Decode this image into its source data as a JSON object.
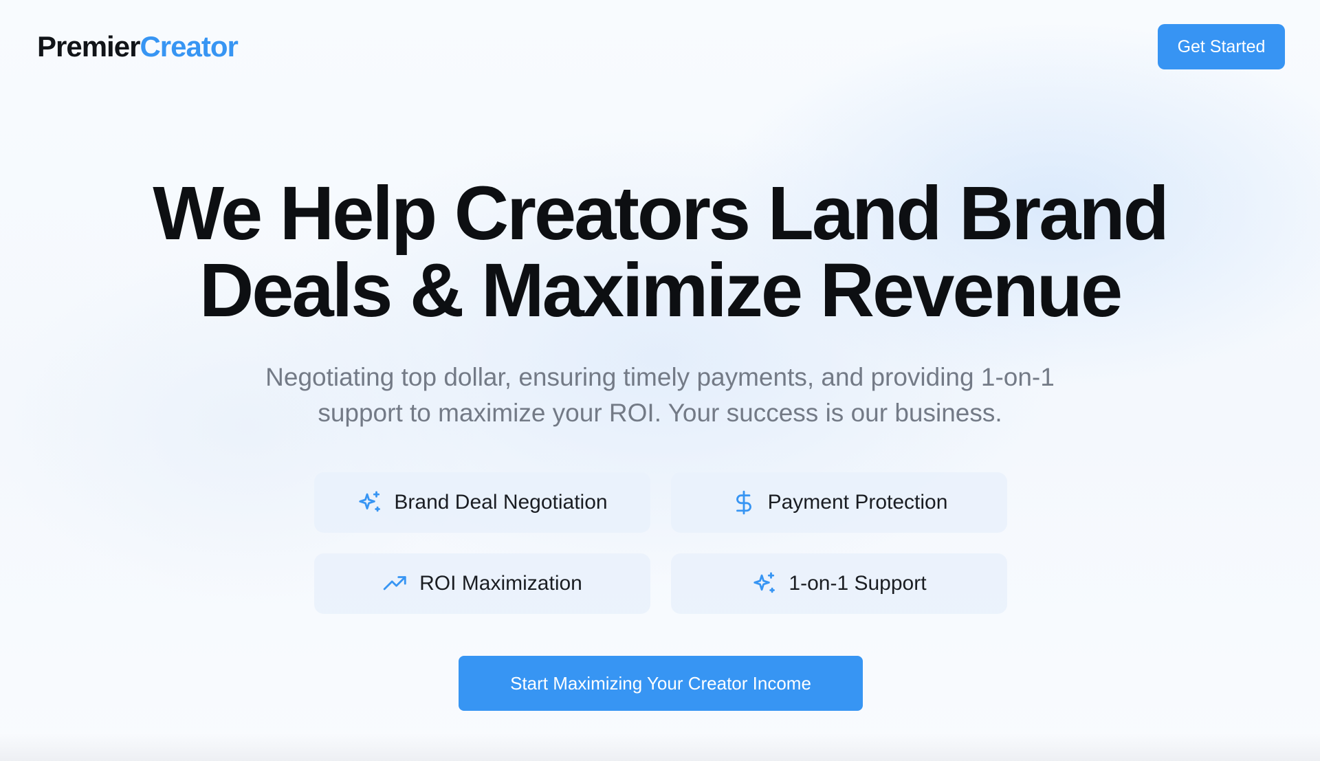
{
  "brand": {
    "name_part1": "Premier",
    "name_part2": "Creator",
    "colors": {
      "text": "#111418",
      "accent": "#3795f3"
    }
  },
  "header": {
    "cta_label": "Get Started"
  },
  "hero": {
    "title_line1": "We Help Creators Land Brand",
    "title_line2": "Deals & Maximize Revenue",
    "subtitle": "Negotiating top dollar, ensuring timely payments, and providing 1-on-1 support to maximize your ROI. Your success is our business."
  },
  "features": [
    {
      "label": "Brand Deal Negotiation",
      "icon": "sparkles-icon"
    },
    {
      "label": "Payment Protection",
      "icon": "dollar-sign-icon"
    },
    {
      "label": "ROI Maximization",
      "icon": "trending-up-icon"
    },
    {
      "label": "1-on-1 Support",
      "icon": "sparkles-icon"
    }
  ],
  "cta": {
    "label": "Start Maximizing Your Creator Income"
  }
}
